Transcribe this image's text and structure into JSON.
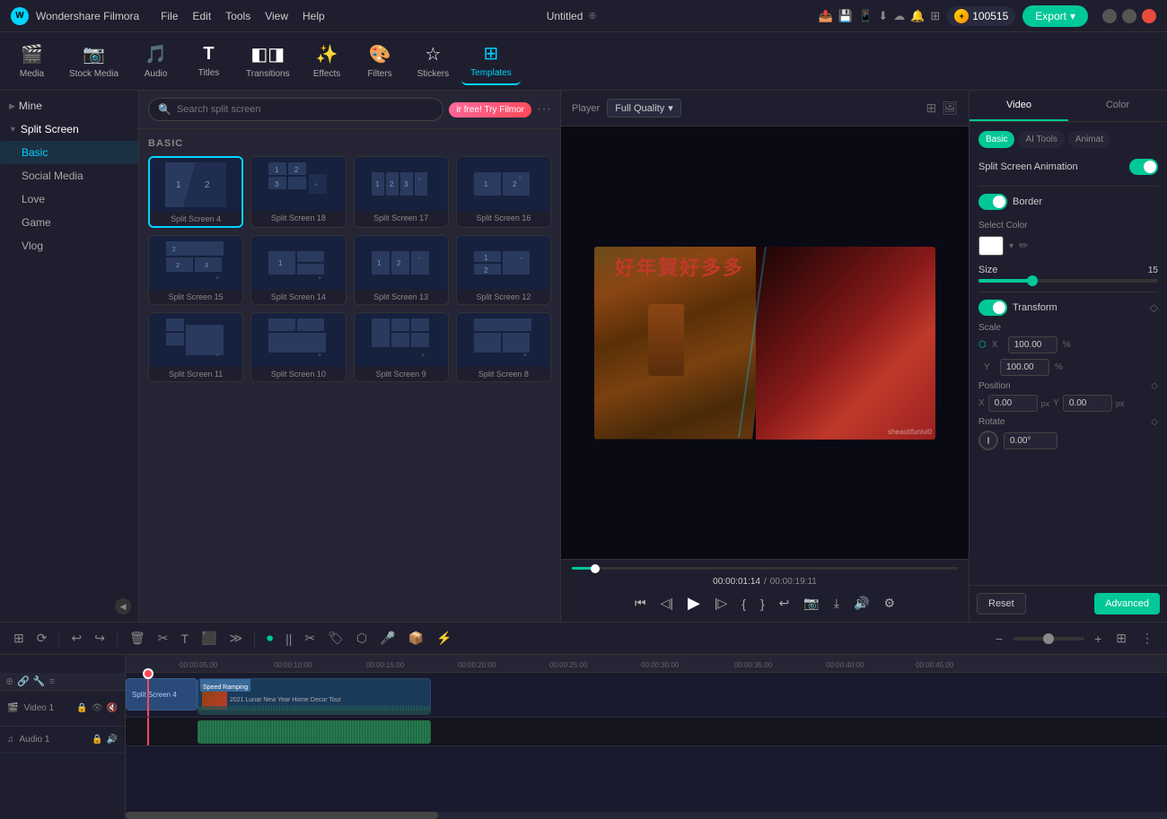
{
  "app": {
    "name": "Wondershare Filmora",
    "title": "Untitled",
    "coin_count": "100515"
  },
  "titlebar": {
    "menu": [
      "File",
      "Edit",
      "Tools",
      "View",
      "Help"
    ],
    "export_label": "Export"
  },
  "toolbar": {
    "items": [
      {
        "id": "media",
        "label": "Media",
        "icon": "🎬"
      },
      {
        "id": "stock_media",
        "label": "Stock Media",
        "icon": "📷"
      },
      {
        "id": "audio",
        "label": "Audio",
        "icon": "🎵"
      },
      {
        "id": "titles",
        "label": "Titles",
        "icon": "T"
      },
      {
        "id": "transitions",
        "label": "Transitions",
        "icon": "⟨⟩"
      },
      {
        "id": "effects",
        "label": "Effects",
        "icon": "✨"
      },
      {
        "id": "filters",
        "label": "Filters",
        "icon": "🎨"
      },
      {
        "id": "stickers",
        "label": "Stickers",
        "icon": "☆"
      },
      {
        "id": "templates",
        "label": "Templates",
        "icon": "⊞",
        "active": true
      }
    ]
  },
  "sidebar": {
    "items": [
      {
        "label": "Mine",
        "indent": 0,
        "arrow": "▶"
      },
      {
        "label": "Split Screen",
        "indent": 0,
        "arrow": "▼",
        "active": false
      },
      {
        "label": "Basic",
        "indent": 1,
        "active": true
      },
      {
        "label": "Social Media",
        "indent": 1
      },
      {
        "label": "Love",
        "indent": 1
      },
      {
        "label": "Game",
        "indent": 1
      },
      {
        "label": "Vlog",
        "indent": 1
      }
    ]
  },
  "templates_panel": {
    "search_placeholder": "Search split screen",
    "promo_text": "ir free! Try Filmor",
    "section_label": "BASIC",
    "templates": [
      {
        "label": "Split Screen 4",
        "selected": true
      },
      {
        "label": "Split Screen 18"
      },
      {
        "label": "Split Screen 17"
      },
      {
        "label": "Split Screen 16"
      },
      {
        "label": "Split Screen 15"
      },
      {
        "label": "Split Screen 14"
      },
      {
        "label": "Split Screen 13"
      },
      {
        "label": "Split Screen 12"
      },
      {
        "label": "Split Screen 11"
      },
      {
        "label": "Split Screen 10"
      },
      {
        "label": "Split Screen 9"
      },
      {
        "label": "Split Screen 8"
      }
    ]
  },
  "preview": {
    "player_label": "Player",
    "quality": "Full Quality",
    "time_current": "00:00:01:14",
    "time_total": "00:00:19:11",
    "watermark": "sheautifunivi0"
  },
  "right_panel": {
    "tabs": [
      "Video",
      "Color"
    ],
    "active_tab": "Video",
    "sub_tabs": [
      "Basic",
      "AI Tools",
      "Animat"
    ],
    "active_sub_tab": "Basic",
    "split_screen_animation": "Split Screen Animation",
    "split_animation_on": true,
    "border_label": "Border",
    "border_on": true,
    "select_color_label": "Select Color",
    "size_label": "Size",
    "size_value": "15",
    "transform_label": "Transform",
    "transform_on": true,
    "scale_label": "Scale",
    "scale_x": "100.00",
    "scale_y": "100.00",
    "scale_unit": "%",
    "position_label": "Position",
    "position_x": "0.00",
    "position_y": "0.00",
    "position_unit": "px",
    "rotate_label": "Rotate",
    "rotate_value": "0.00°",
    "reset_label": "Reset",
    "advanced_label": "Advanced"
  },
  "timeline": {
    "track_labels": [
      "Video 1",
      "Audio 1"
    ],
    "time_markers": [
      "00:00:05:00",
      "00:00:10:00",
      "00:00:15:00",
      "00:00:20:00",
      "00:00:25:00",
      "00:00:30:00",
      "00:00:35:00",
      "00:00:40:00",
      "00:00:45:00"
    ],
    "clips": [
      {
        "name": "Split Screen 4",
        "type": "split"
      },
      {
        "name": "Speed Ramping",
        "type": "badge"
      },
      {
        "name": "2021 Lunar New Year Home Decor Tour",
        "type": "video"
      }
    ]
  }
}
